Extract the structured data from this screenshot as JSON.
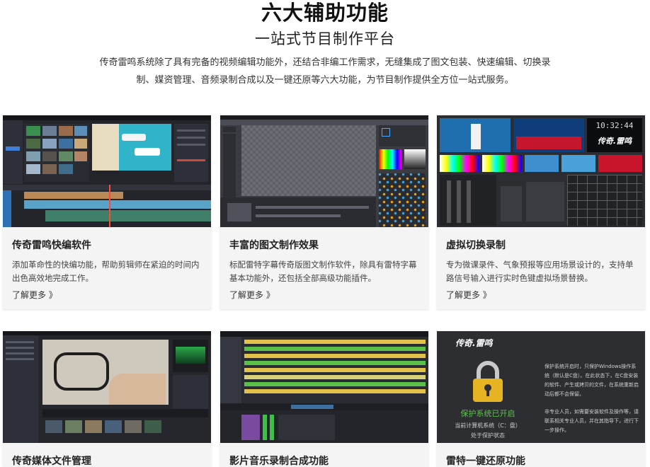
{
  "header": {
    "title": "六大辅助功能",
    "subtitle": "一站式节目制作平台",
    "description": "传奇雷鸣系统除了具有完备的视频编辑功能外，还结合非编工作需求，无缝集成了图文包装、快速编辑、切换录制、媒资管理、音频录制合成以及一键还原等六大功能，为节目制作提供全方位一站式服务。"
  },
  "cards": [
    {
      "title": "传奇雷鸣快编软件",
      "text": "添加革命性的快编功能，帮助剪辑师在紧迫的时间内出色高效地完成工作。",
      "link": "了解更多 》"
    },
    {
      "title": "丰富的图文制作效果",
      "text": "标配雷特字幕传奇版图文制作软件，除具有雷特字幕基本功能外，还包括全部高级功能插件。",
      "link": "了解更多 》"
    },
    {
      "title": "虚拟切换录制",
      "text": "专为微课录件、气象预报等应用场景设计的，支持单路信号输入进行实时色键虚拟场景替换。",
      "link": "了解更多 》"
    },
    {
      "title": "传奇媒体文件管理",
      "text": "",
      "link": ""
    },
    {
      "title": "影片音乐录制合成功能",
      "text": "",
      "link": ""
    },
    {
      "title": "雷特一键还原功能",
      "text": "",
      "link": ""
    }
  ],
  "shots": {
    "switcher": {
      "clock": "10:32:44",
      "logo": "传奇.雷鸣"
    },
    "restore": {
      "logo": "传奇.雷鸣",
      "status": "保护系统已开启",
      "drive_line": "当前计算机系统（C：盘）",
      "state_line": "处于保护状态",
      "info1": "保护系统开启时，只保护Windows操作系统（默认是C盘）。在此状态下，在C盘安装的软件、产生或拷贝的文件，在系统重新启动后都不会保留。",
      "info2": "非专业人员，如需要安装软件及操作等，请联系相关专业人员，并在其指导下，进行下一步操作。"
    }
  },
  "colors": {
    "card_bg": "#f4f4f4",
    "gold_lock": "#e6b422",
    "restore_green": "#5cc34a"
  }
}
